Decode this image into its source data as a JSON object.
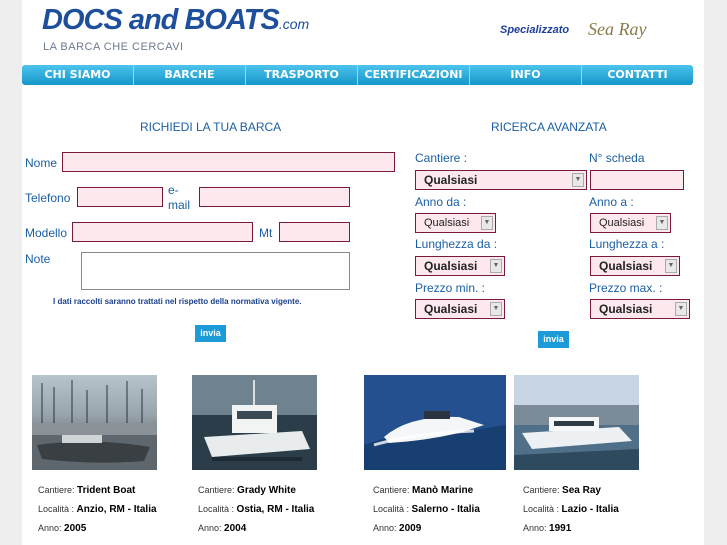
{
  "header": {
    "logo_main": "DOCS and BOATS",
    "logo_suffix": ".com",
    "tagline": "LA BARCA CHE CERCAVI",
    "specializzato": "Specializzato",
    "brand": "Sea Ray"
  },
  "nav": {
    "items": [
      "CHI SIAMO",
      "BARCHE",
      "TRASPORTO",
      "CERTIFICAZIONI",
      "INFO",
      "CONTATTI"
    ]
  },
  "request_form": {
    "title": "RICHIEDI LA TUA BARCA",
    "nome_label": "Nome",
    "telefono_label": "Telefono",
    "email_label": "e-mail",
    "modello_label": "Modello",
    "mt_label": "Mt",
    "note_label": "Note",
    "privacy_text": "I dati raccolti saranno trattati nel rispetto della normativa vigente.",
    "submit_label": "invia"
  },
  "advanced_search": {
    "title": "RICERCA AVANZATA",
    "cantiere_label": "Cantiere :",
    "scheda_label": "N° scheda",
    "anno_da_label": "Anno da :",
    "anno_a_label": "Anno a :",
    "lunghezza_da_label": "Lunghezza da :",
    "lunghezza_a_label": "Lunghezza a :",
    "prezzo_min_label": "Prezzo min. :",
    "prezzo_max_label": "Prezzo max. :",
    "select_value": "Qualsiasi",
    "submit_label": "invia"
  },
  "listings": {
    "cantiere_label": "Cantiere:",
    "localita_label": "Località :",
    "anno_label": "Anno:",
    "items": [
      {
        "cantiere": "Trident Boat",
        "localita": "Anzio, RM - Italia",
        "anno": "2005"
      },
      {
        "cantiere": "Grady White",
        "localita": "Ostia, RM - Italia",
        "anno": "2004"
      },
      {
        "cantiere": "Manò Marine",
        "localita": "Salerno - Italia",
        "anno": "2009"
      },
      {
        "cantiere": "Sea Ray",
        "localita": "Lazio - Italia",
        "anno": "1991"
      }
    ]
  },
  "colors": {
    "accent": "#1b5fa3",
    "nav": "#1596c9",
    "input_bg": "#fde8ee",
    "input_border": "#7a1a3a"
  }
}
